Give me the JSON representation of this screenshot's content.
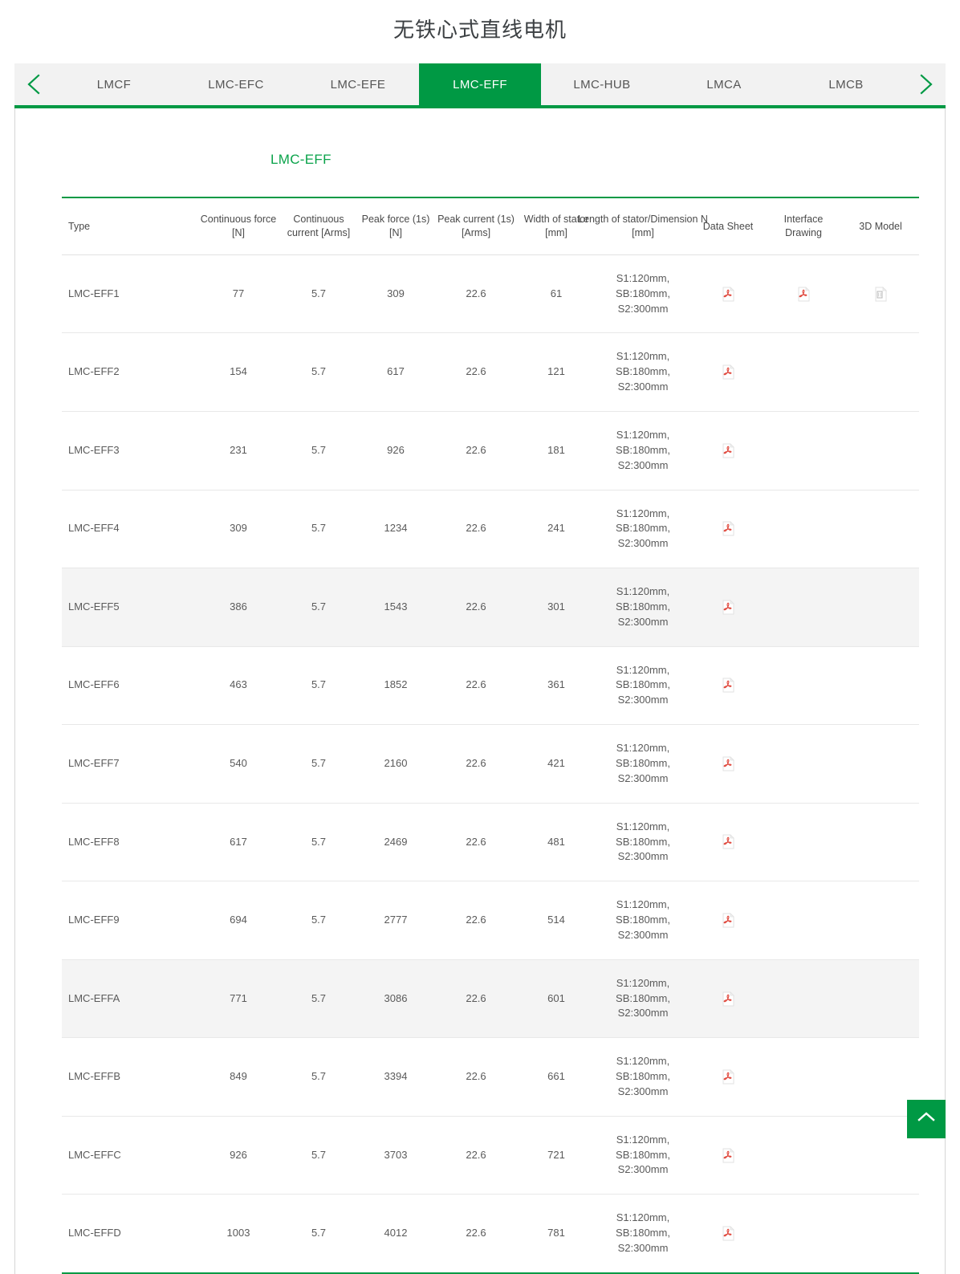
{
  "page": {
    "title": "无铁心式直线电机"
  },
  "tabbar": {
    "prev_label": "‹",
    "next_label": "›",
    "tabs": [
      {
        "label": "LMCF",
        "active": false
      },
      {
        "label": "LMC-EFC",
        "active": false
      },
      {
        "label": "LMC-EFE",
        "active": false
      },
      {
        "label": "LMC-EFF",
        "active": true
      },
      {
        "label": "LMC-HUB",
        "active": false
      },
      {
        "label": "LMCA",
        "active": false
      },
      {
        "label": "LMCB",
        "active": false
      }
    ]
  },
  "section": {
    "title": "LMC-EFF"
  },
  "table": {
    "headers": [
      "Type",
      "Continuous force [N]",
      "Continuous current [Arms]",
      "Peak force (1s) [N]",
      "Peak current (1s) [Arms]",
      "Width of stator [mm]",
      "Length of stator/Dimension N [mm]",
      "Data Sheet",
      "Interface Drawing",
      "3D Model"
    ],
    "rows": [
      {
        "type": "LMC-EFF1",
        "continuous_force": "77",
        "continuous_current": "5.7",
        "peak_force": "309",
        "peak_current": "22.6",
        "width_stator": "61",
        "length_stator": "S1:120mm,\nSB:180mm,\nS2:300mm",
        "data_sheet": "pdf-icon",
        "interface_drawing": "pdf-icon",
        "model_3d": "doc-3d-icon",
        "alt": false
      },
      {
        "type": "LMC-EFF2",
        "continuous_force": "154",
        "continuous_current": "5.7",
        "peak_force": "617",
        "peak_current": "22.6",
        "width_stator": "121",
        "length_stator": "S1:120mm,\nSB:180mm,\nS2:300mm",
        "data_sheet": "pdf-icon",
        "interface_drawing": "",
        "model_3d": "",
        "alt": false
      },
      {
        "type": "LMC-EFF3",
        "continuous_force": "231",
        "continuous_current": "5.7",
        "peak_force": "926",
        "peak_current": "22.6",
        "width_stator": "181",
        "length_stator": "S1:120mm,\nSB:180mm,\nS2:300mm",
        "data_sheet": "pdf-icon",
        "interface_drawing": "",
        "model_3d": "",
        "alt": false
      },
      {
        "type": "LMC-EFF4",
        "continuous_force": "309",
        "continuous_current": "5.7",
        "peak_force": "1234",
        "peak_current": "22.6",
        "width_stator": "241",
        "length_stator": "S1:120mm,\nSB:180mm,\nS2:300mm",
        "data_sheet": "pdf-icon",
        "interface_drawing": "",
        "model_3d": "",
        "alt": false
      },
      {
        "type": "LMC-EFF5",
        "continuous_force": "386",
        "continuous_current": "5.7",
        "peak_force": "1543",
        "peak_current": "22.6",
        "width_stator": "301",
        "length_stator": "S1:120mm,\nSB:180mm,\nS2:300mm",
        "data_sheet": "pdf-icon",
        "interface_drawing": "",
        "model_3d": "",
        "alt": true
      },
      {
        "type": "LMC-EFF6",
        "continuous_force": "463",
        "continuous_current": "5.7",
        "peak_force": "1852",
        "peak_current": "22.6",
        "width_stator": "361",
        "length_stator": "S1:120mm,\nSB:180mm,\nS2:300mm",
        "data_sheet": "pdf-icon",
        "interface_drawing": "",
        "model_3d": "",
        "alt": false
      },
      {
        "type": "LMC-EFF7",
        "continuous_force": "540",
        "continuous_current": "5.7",
        "peak_force": "2160",
        "peak_current": "22.6",
        "width_stator": "421",
        "length_stator": "S1:120mm,\nSB:180mm,\nS2:300mm",
        "data_sheet": "pdf-icon",
        "interface_drawing": "",
        "model_3d": "",
        "alt": false
      },
      {
        "type": "LMC-EFF8",
        "continuous_force": "617",
        "continuous_current": "5.7",
        "peak_force": "2469",
        "peak_current": "22.6",
        "width_stator": "481",
        "length_stator": "S1:120mm,\nSB:180mm,\nS2:300mm",
        "data_sheet": "pdf-icon",
        "interface_drawing": "",
        "model_3d": "",
        "alt": false
      },
      {
        "type": "LMC-EFF9",
        "continuous_force": "694",
        "continuous_current": "5.7",
        "peak_force": "2777",
        "peak_current": "22.6",
        "width_stator": "514",
        "length_stator": "S1:120mm,\nSB:180mm,\nS2:300mm",
        "data_sheet": "pdf-icon",
        "interface_drawing": "",
        "model_3d": "",
        "alt": false
      },
      {
        "type": "LMC-EFFA",
        "continuous_force": "771",
        "continuous_current": "5.7",
        "peak_force": "3086",
        "peak_current": "22.6",
        "width_stator": "601",
        "length_stator": "S1:120mm,\nSB:180mm,\nS2:300mm",
        "data_sheet": "pdf-icon",
        "interface_drawing": "",
        "model_3d": "",
        "alt": true
      },
      {
        "type": "LMC-EFFB",
        "continuous_force": "849",
        "continuous_current": "5.7",
        "peak_force": "3394",
        "peak_current": "22.6",
        "width_stator": "661",
        "length_stator": "S1:120mm,\nSB:180mm,\nS2:300mm",
        "data_sheet": "pdf-icon",
        "interface_drawing": "",
        "model_3d": "",
        "alt": false
      },
      {
        "type": "LMC-EFFC",
        "continuous_force": "926",
        "continuous_current": "5.7",
        "peak_force": "3703",
        "peak_current": "22.6",
        "width_stator": "721",
        "length_stator": "S1:120mm,\nSB:180mm,\nS2:300mm",
        "data_sheet": "pdf-icon",
        "interface_drawing": "",
        "model_3d": "",
        "alt": false
      },
      {
        "type": "LMC-EFFD",
        "continuous_force": "1003",
        "continuous_current": "5.7",
        "peak_force": "4012",
        "peak_current": "22.6",
        "width_stator": "781",
        "length_stator": "S1:120mm,\nSB:180mm,\nS2:300mm",
        "data_sheet": "pdf-icon",
        "interface_drawing": "",
        "model_3d": "",
        "alt": false
      }
    ]
  },
  "scroll_top": {
    "icon": "chevron-up-icon"
  },
  "colors": {
    "brand_green": "#009944",
    "section_green": "#0aa34a",
    "tabbar_bg": "#f2f2f2",
    "alt_row": "#f4f4f4",
    "pdf_red": "#e04a3f"
  }
}
